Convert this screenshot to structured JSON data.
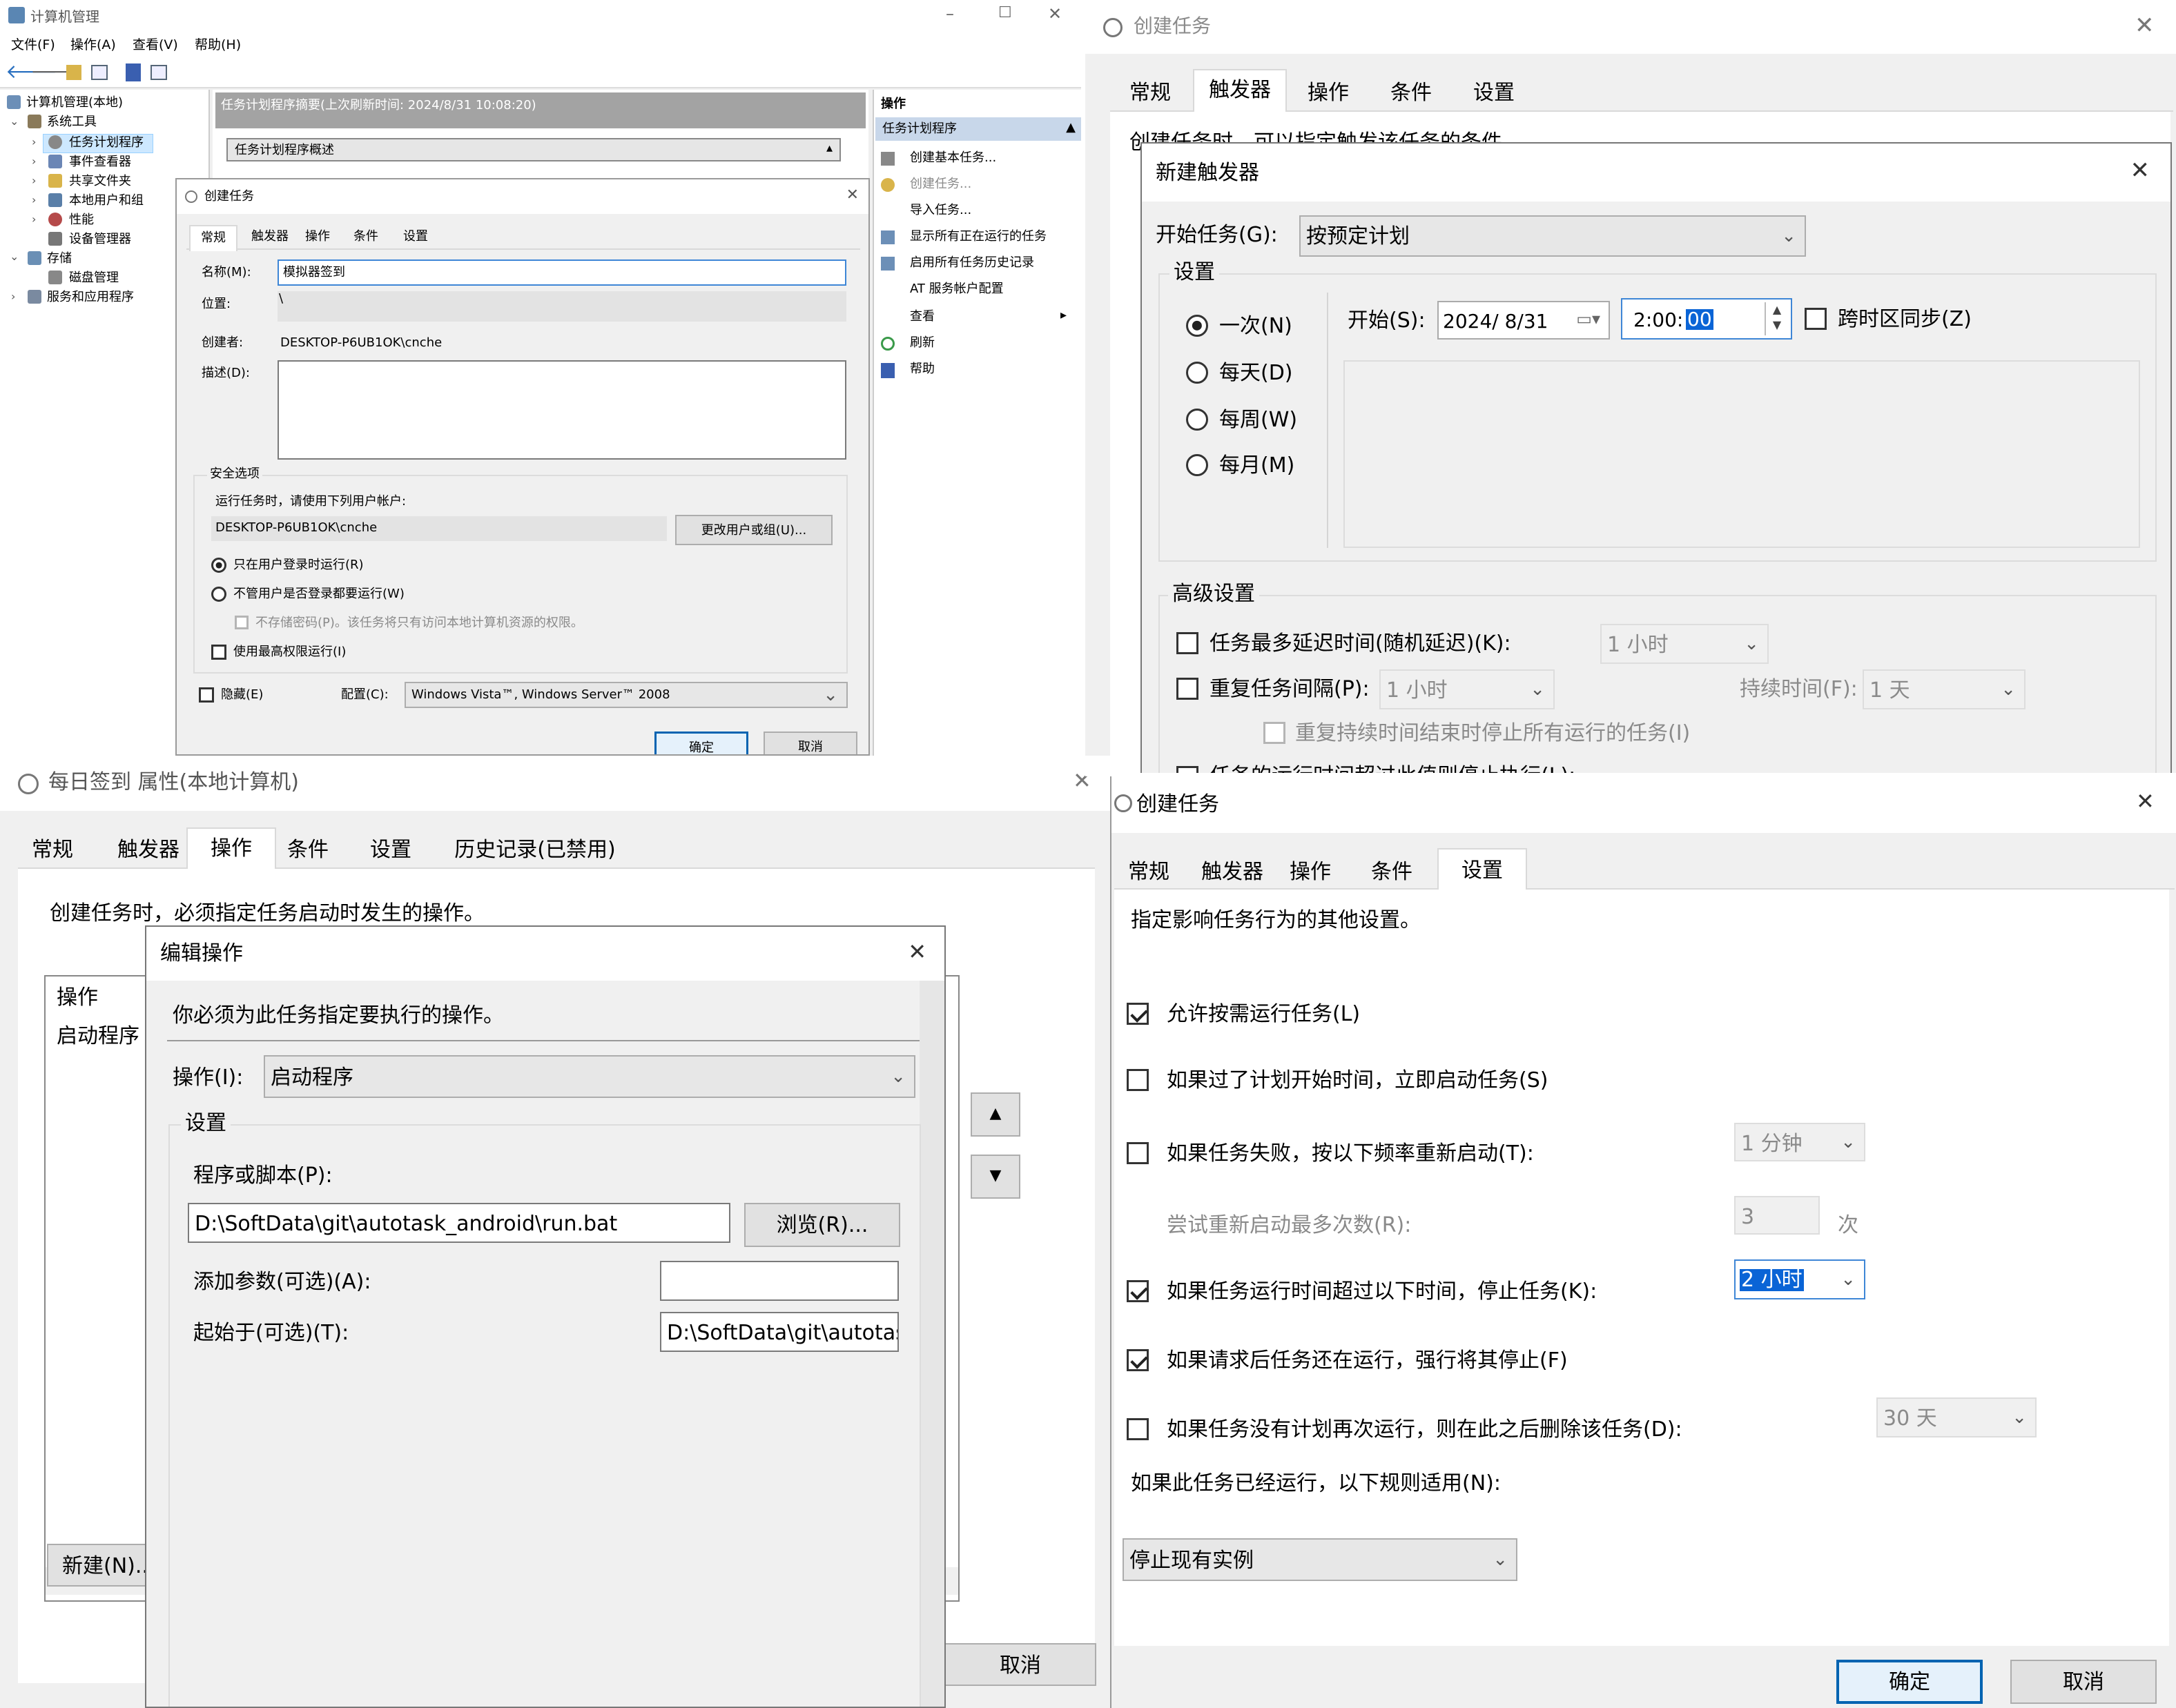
{
  "cm": {
    "title": "计算机管理",
    "menu": [
      "文件(F)",
      "操作(A)",
      "查看(V)",
      "帮助(H)"
    ],
    "tree": {
      "root": "计算机管理(本地)",
      "items": [
        "系统工具",
        "任务计划程序",
        "事件查看器",
        "共享文件夹",
        "本地用户和组",
        "性能",
        "设备管理器",
        "存储",
        "磁盘管理",
        "服务和应用程序"
      ]
    },
    "center_header": "任务计划程序摘要(上次刷新时间: 2024/8/31 10:08:20)",
    "center_combo": "任务计划程序概述",
    "actions_title": "操作",
    "actions_section": "任务计划程序",
    "actions": [
      "创建基本任务...",
      "创建任务...",
      "导入任务...",
      "显示所有正在运行的任务",
      "启用所有任务历史记录",
      "AT 服务帐户配置",
      "查看",
      "刷新",
      "帮助"
    ]
  },
  "ct_small": {
    "title": "创建任务",
    "tabs": [
      "常规",
      "触发器",
      "操作",
      "条件",
      "设置"
    ],
    "name_label": "名称(M):",
    "name_value": "模拟器签到",
    "location_label": "位置:",
    "location_value": "\\",
    "author_label": "创建者:",
    "author_value": "DESKTOP-P6UB1OK\\cnche",
    "desc_label": "描述(D):",
    "security_title": "安全选项",
    "security_hint": "运行任务时，请使用下列用户帐户:",
    "account": "DESKTOP-P6UB1OK\\cnche",
    "change_user_btn": "更改用户或组(U)...",
    "radio_logged": "只在用户登录时运行(R)",
    "radio_any": "不管用户是否登录都要运行(W)",
    "no_store_pwd": "不存储密码(P)。该任务将只有访问本地计算机资源的权限。",
    "highest": "使用最高权限运行(I)",
    "hidden": "隐藏(E)",
    "config_label": "配置(C):",
    "config_value": "Windows Vista™, Windows Server™ 2008",
    "ok": "确定",
    "cancel": "取消"
  },
  "tr_parent": {
    "title": "创建任务",
    "tabs": [
      "常规",
      "触发器",
      "操作",
      "条件",
      "设置"
    ],
    "hint": "创建任务时，可以指定触发该任务的条件。"
  },
  "new_trigger": {
    "title": "新建触发器",
    "begin_label": "开始任务(G):",
    "begin_value": "按预定计划",
    "settings_label": "设置",
    "radios": [
      "一次(N)",
      "每天(D)",
      "每周(W)",
      "每月(M)"
    ],
    "start_label": "开始(S):",
    "start_date": "2024/ 8/31",
    "start_time_prefix": "2:00:",
    "start_time_sel": "00",
    "sync_tz": "跨时区同步(Z)",
    "advanced_label": "高级设置",
    "delay_label": "任务最多延迟时间(随机延迟)(K):",
    "delay_value": "1 小时",
    "repeat_label": "重复任务间隔(P):",
    "repeat_value": "1 小时",
    "duration_label": "持续时间(F):",
    "duration_value": "1 天",
    "stop_repeat": "重复持续时间结束时停止所有运行的任务(I)",
    "stop_longer": "任务的运行时间超过此值则停止执行(L):"
  },
  "props": {
    "title": "每日签到 属性(本地计算机)",
    "tabs": [
      "常规",
      "触发器",
      "操作",
      "条件",
      "设置",
      "历史记录(已禁用)"
    ],
    "hint": "创建任务时，必须指定任务启动时发生的操作。",
    "col_action": "操作",
    "row_action": "启动程序",
    "new_btn": "新建(N)...",
    "cancel": "取消"
  },
  "edit_action": {
    "title": "编辑操作",
    "hint": "你必须为此任务指定要执行的操作。",
    "action_label": "操作(I):",
    "action_value": "启动程序",
    "settings_label": "设置",
    "program_label": "程序或脚本(P):",
    "program_value": "D:\\SoftData\\git\\autotask_android\\run.bat",
    "browse_btn": "浏览(R)...",
    "args_label": "添加参数(可选)(A):",
    "args_value": "",
    "startin_label": "起始于(可选)(T):",
    "startin_value": "D:\\SoftData\\git\\autotasl"
  },
  "settings_dlg": {
    "title": "创建任务",
    "tabs": [
      "常规",
      "触发器",
      "操作",
      "条件",
      "设置"
    ],
    "hint": "指定影响任务行为的其他设置。",
    "allow_demand": "允许按需运行任务(L)",
    "run_missed": "如果过了计划开始时间，立即启动任务(S)",
    "restart_fail": "如果任务失败，按以下频率重新启动(T):",
    "restart_value": "1 分钟",
    "retry_label": "尝试重新启动最多次数(R):",
    "retry_value": "3",
    "retry_unit": "次",
    "stop_longer": "如果任务运行时间超过以下时间，停止任务(K):",
    "stop_value": "2 小时",
    "force_stop": "如果请求后任务还在运行，强行将其停止(F)",
    "delete_after": "如果任务没有计划再次运行，则在此之后删除该任务(D):",
    "delete_value": "30 天",
    "rule_label": "如果此任务已经运行，以下规则适用(N):",
    "rule_value": "停止现有实例",
    "ok": "确定",
    "cancel": "取消"
  }
}
